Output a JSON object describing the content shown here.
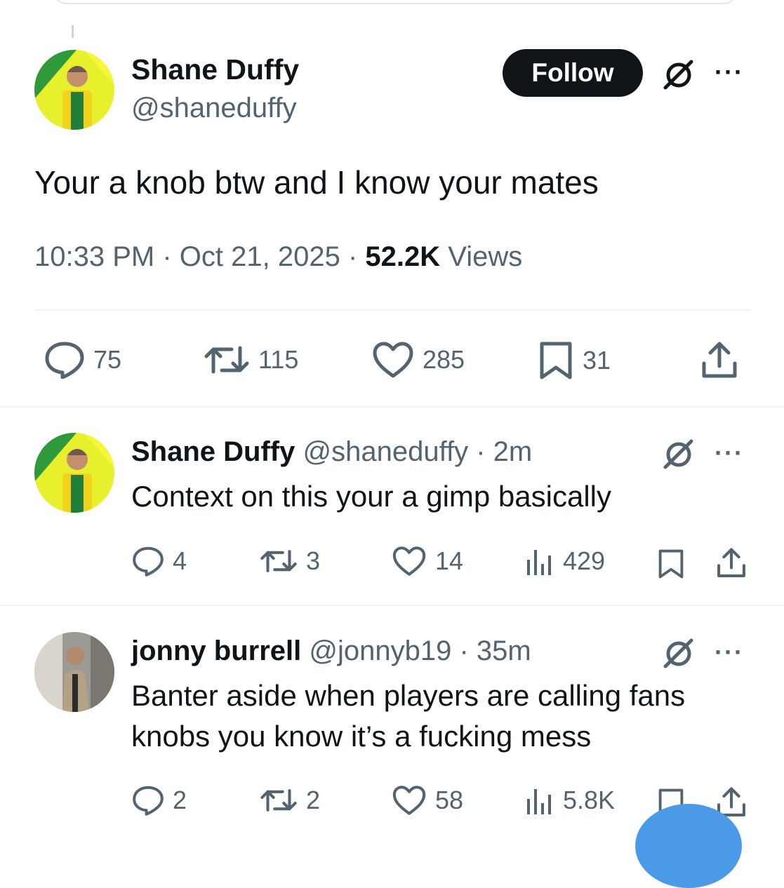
{
  "main_tweet": {
    "display_name": "Shane Duffy",
    "handle": "@shaneduffy",
    "follow_label": "Follow",
    "text": "Your a knob btw and I know your mates",
    "time": "10:33 PM",
    "sep1": "·",
    "date": "Oct 21, 2025",
    "sep2": "·",
    "views_count": "52.2K",
    "views_label": "Views",
    "replies": "75",
    "reposts": "115",
    "likes": "285",
    "bookmarks": "31"
  },
  "replies": [
    {
      "display_name": "Shane Duffy",
      "handle": "@shaneduffy",
      "age": "· 2m",
      "text_lines": [
        "Context on this your a gimp basically"
      ],
      "replies": "4",
      "reposts": "3",
      "likes": "14",
      "views": "429"
    },
    {
      "display_name": "jonny burrell",
      "handle": "@jonnyb19",
      "age": "· 35m",
      "text_lines": [
        "Banter aside when players are calling fans",
        "knobs you know it’s a fucking mess"
      ],
      "replies": "2",
      "reposts": "2",
      "likes": "58",
      "views": "5.8K"
    }
  ],
  "ui": {
    "more": "···"
  },
  "colors": {
    "text": "#0f1419",
    "muted": "#536471",
    "divider": "#eff3f4",
    "compose_button": "#4a9ae8"
  },
  "icons": [
    "reply-icon",
    "repost-icon",
    "like-icon",
    "bookmark-icon",
    "share-icon",
    "views-icon",
    "grok-icon",
    "more-icon"
  ]
}
